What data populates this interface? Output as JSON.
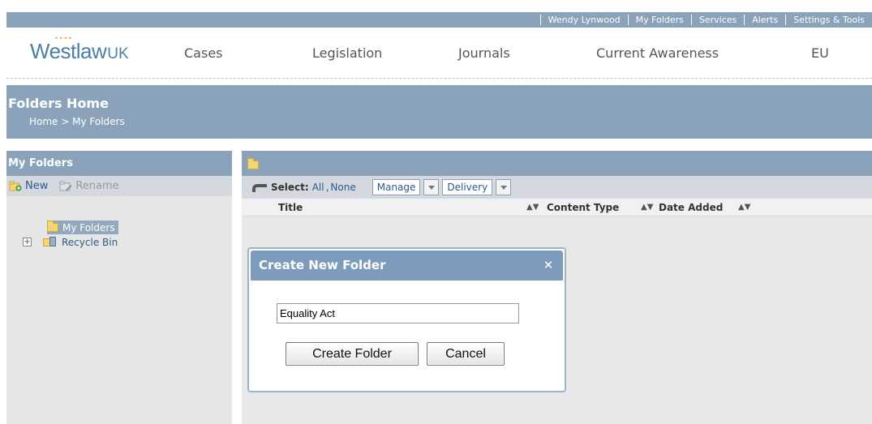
{
  "utility_links": [
    "Wendy Lynwood",
    "My Folders",
    "Services",
    "Alerts",
    "Settings & Tools"
  ],
  "logo": {
    "word": "Westlaw",
    "suffix": "UK"
  },
  "nav": [
    "Cases",
    "Legislation",
    "Journals",
    "Current Awareness",
    "EU"
  ],
  "page": {
    "title": "Folders Home",
    "breadcrumb": "Home > My Folders"
  },
  "sidebar": {
    "title": "My Folders",
    "new_label": "New",
    "rename_label": "Rename",
    "tree": [
      {
        "label": "My Folders",
        "selected": true
      },
      {
        "label": "Recycle Bin",
        "selected": false
      }
    ]
  },
  "toolbar": {
    "select_label": "Select:",
    "all_label": "All",
    "separator": ",",
    "none_label": "None",
    "manage_label": "Manage",
    "delivery_label": "Delivery"
  },
  "columns": [
    "Title",
    "Content Type",
    "Date Added"
  ],
  "dialog": {
    "title": "Create New Folder",
    "input_value": "Equality Act",
    "create_label": "Create Folder",
    "cancel_label": "Cancel"
  },
  "colors": {
    "bar": "#8aa3bb",
    "dialog_header": "#7d9bbb",
    "link": "#2a5a8a",
    "logo": "#4a7fa8"
  }
}
